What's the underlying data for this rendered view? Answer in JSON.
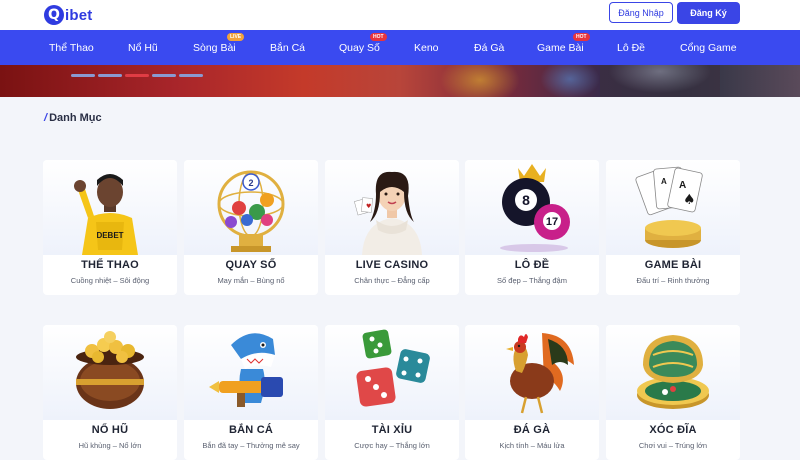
{
  "header": {
    "logo_mark": "Q",
    "logo_text": "ibet",
    "login_label": "Đăng Nhập",
    "register_label": "Đăng Ký"
  },
  "nav": {
    "items": [
      {
        "label": "Thể Thao"
      },
      {
        "label": "Nổ Hũ"
      },
      {
        "label": "Sòng Bài",
        "badge": "LIVE"
      },
      {
        "label": "Bắn Cá"
      },
      {
        "label": "Quay Số",
        "badge": "HOT"
      },
      {
        "label": "Keno"
      },
      {
        "label": "Đá Gà"
      },
      {
        "label": "Game Bài",
        "badge": "HOT"
      },
      {
        "label": "Lô Đề"
      },
      {
        "label": "Cổng Game"
      }
    ]
  },
  "banner": {
    "slide_count": 5,
    "active_index": 2
  },
  "section": {
    "title": "Danh Mục"
  },
  "categories": [
    {
      "name": "THỂ THAO",
      "subtitle": "Cuồng nhiệt – Sôi động",
      "art": "football-player-icon"
    },
    {
      "name": "QUAY SỐ",
      "subtitle": "May mắn – Bùng nổ",
      "art": "lottery-cage-icon"
    },
    {
      "name": "LIVE CASINO",
      "subtitle": "Chân thực – Đẳng cấp",
      "art": "casino-dealer-icon"
    },
    {
      "name": "LÔ ĐỀ",
      "subtitle": "Số đẹp – Thắng đậm",
      "art": "lottery-balls-icon"
    },
    {
      "name": "GAME BÀI",
      "subtitle": "Đấu trí – Rinh thưởng",
      "art": "playing-cards-icon"
    },
    {
      "name": "NỔ HŨ",
      "subtitle": "Hũ khủng – Nổ lớn",
      "art": "gold-pot-icon"
    },
    {
      "name": "BẮN CÁ",
      "subtitle": "Bắn đã tay – Thưởng mê say",
      "art": "shark-gun-icon"
    },
    {
      "name": "TÀI XỈU",
      "subtitle": "Cược hay – Thắng lớn",
      "art": "dice-icon"
    },
    {
      "name": "ĐÁ GÀ",
      "subtitle": "Kịch tính – Máu lửa",
      "art": "rooster-icon"
    },
    {
      "name": "XÓC ĐĨA",
      "subtitle": "Chơi vui – Trúng lớn",
      "art": "coin-disc-icon"
    }
  ],
  "colors": {
    "brand": "#3a45e6",
    "nav_bg": "#3a4af0",
    "live_badge": "#f1a23b",
    "hot_badge": "#e8343d",
    "active_dot": "#e03c44"
  }
}
